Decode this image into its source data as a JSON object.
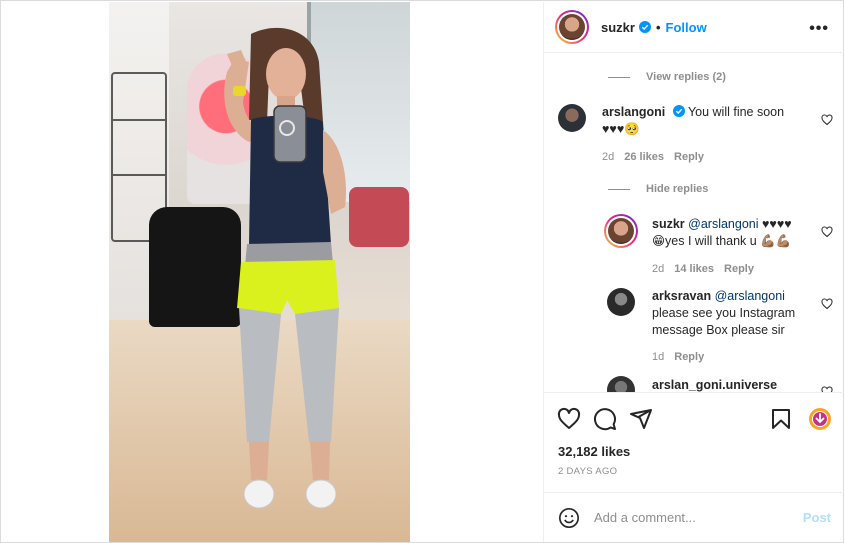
{
  "colors": {
    "accent": "#0095f6",
    "border": "#dbdbdb",
    "muted": "#8e8e8e",
    "text": "#262626",
    "mention": "#00376b"
  },
  "post_image": {
    "alt": ""
  },
  "header": {
    "username": "suzkr",
    "separator": "•",
    "follow_label": "Follow",
    "more_label": "•••",
    "icons": {
      "verified": "verified-badge-icon",
      "more": "more-options-icon"
    }
  },
  "comments": {
    "view_replies": "View replies (2)",
    "hide_replies": "Hide replies",
    "items": [
      {
        "username": "arslangoni",
        "verified": true,
        "text": "You will fine soon",
        "line2": "♥♥♥🥺",
        "time": "2d",
        "likes": "26 likes",
        "reply": "Reply"
      },
      {
        "username": "suzkr",
        "mention": "@arslangoni",
        "text_after": "♥♥♥♥",
        "line2": "😁yes I will thank u 💪🏽💪🏽",
        "time": "2d",
        "likes": "14 likes",
        "reply": "Reply"
      },
      {
        "username": "arksravan",
        "mention": "@arslangoni",
        "line2": "please see you Instagram",
        "line3": "message Box please sir",
        "time": "1d",
        "reply": "Reply"
      },
      {
        "username": "arslan_goni.universe"
      }
    ]
  },
  "actions": {
    "likes": "32,182 likes",
    "time_ago": "2 DAYS AGO",
    "icons": [
      "heart-icon",
      "comment-icon",
      "share-icon",
      "bookmark-icon",
      "download-icon"
    ]
  },
  "add_comment": {
    "placeholder": "Add a comment...",
    "post_label": "Post"
  }
}
